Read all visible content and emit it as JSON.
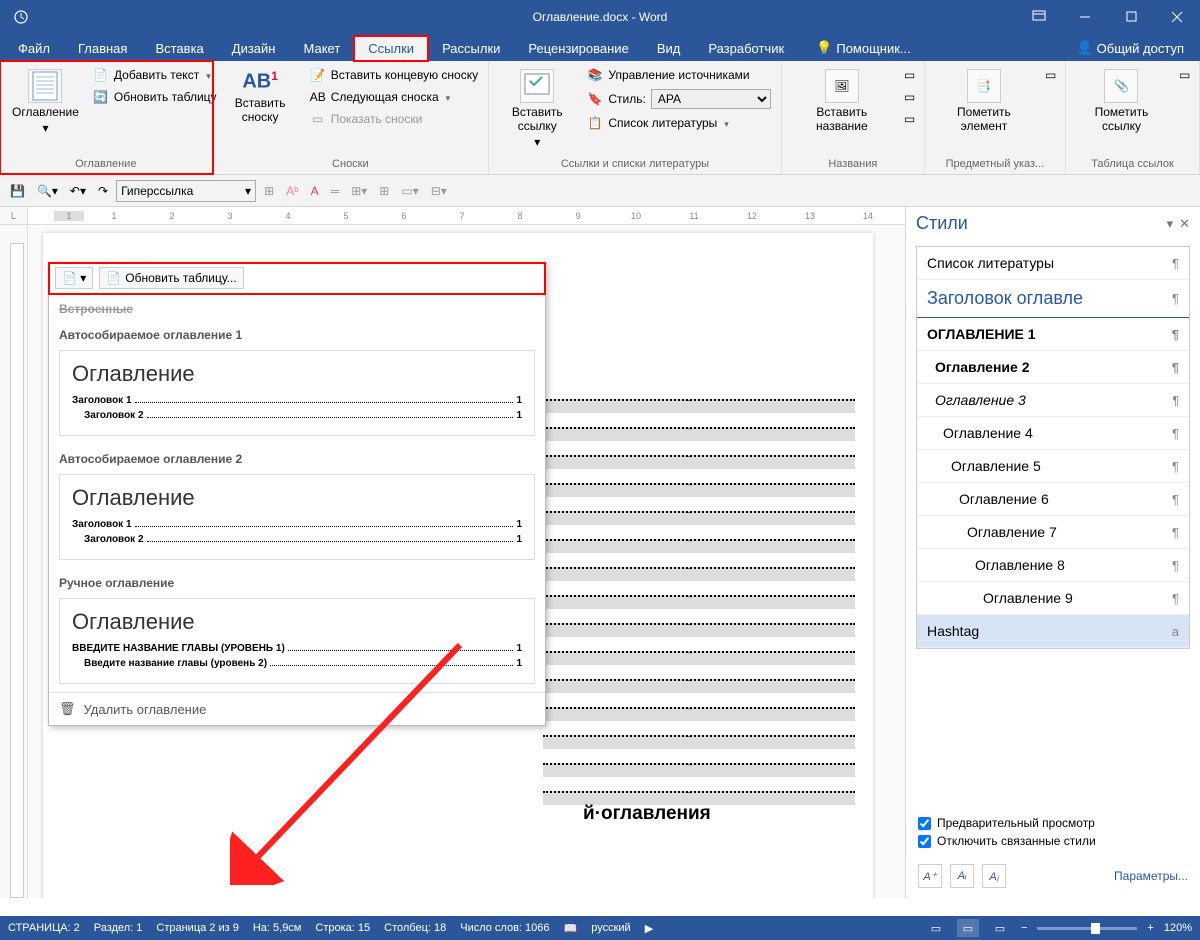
{
  "title": "Оглавление.docx - Word",
  "menutabs": [
    "Файл",
    "Главная",
    "Вставка",
    "Дизайн",
    "Макет",
    "Ссылки",
    "Рассылки",
    "Рецензирование",
    "Вид",
    "Разработчик"
  ],
  "active_tab": "Ссылки",
  "assist_label": "Помощник...",
  "share_label": "Общий доступ",
  "ribbon": {
    "g1": {
      "label": "Оглавление",
      "big": "Оглавление",
      "add_text": "Добавить текст",
      "update_table": "Обновить таблицу"
    },
    "g2": {
      "label": "Сноски",
      "big": "Вставить сноску",
      "ab": "АВ",
      "end_note": "Вставить концевую сноску",
      "next_note": "Следующая сноска",
      "show_notes": "Показать сноски"
    },
    "g3": {
      "label": "Ссылки и списки литературы",
      "big": "Вставить ссылку",
      "manage": "Управление источниками",
      "style_label": "Стиль:",
      "style_value": "APA",
      "bibliography": "Список литературы"
    },
    "g4": {
      "label": "Названия",
      "big": "Вставить название"
    },
    "g5": {
      "label": "Предметный указ...",
      "big": "Пометить элемент"
    },
    "g6": {
      "label": "Таблица ссылок",
      "big": "Пометить ссылку"
    }
  },
  "toolbar2": {
    "style": "Гиперссылка"
  },
  "ruler_numbers": [
    "1",
    "",
    "1",
    "2",
    "3",
    "4",
    "5",
    "6",
    "7",
    "8",
    "9",
    "10",
    "11",
    "12",
    "13",
    "14"
  ],
  "toc_gallery": {
    "update_btn": "Обновить таблицу...",
    "section_builtin": "Встроенные",
    "auto1": "Автособираемое оглавление 1",
    "auto2": "Автособираемое оглавление 2",
    "manual": "Ручное оглавление",
    "preview_title": "Оглавление",
    "h1": "Заголовок 1",
    "h2": "Заголовок 2",
    "m1": "ВВЕДИТЕ НАЗВАНИЕ ГЛАВЫ (УРОВЕНЬ 1)",
    "m2": "Введите название главы (уровень 2)",
    "page1": "1",
    "delete": "Удалить оглавление"
  },
  "doc_fragment": "й·оглавления",
  "styles_pane": {
    "title": "Стили",
    "items": [
      {
        "label": "Список литературы",
        "cls": ""
      },
      {
        "label": "Заголовок оглавле",
        "cls": "heading"
      },
      {
        "label": "ОГЛАВЛЕНИЕ 1",
        "cls": "bold"
      },
      {
        "label": "Оглавление 2",
        "cls": "bold indent-1"
      },
      {
        "label": "Оглавление 3",
        "cls": "italic indent-1"
      },
      {
        "label": "Оглавление 4",
        "cls": "indent-2"
      },
      {
        "label": "Оглавление 5",
        "cls": "indent-3"
      },
      {
        "label": "Оглавление 6",
        "cls": "indent-4"
      },
      {
        "label": "Оглавление 7",
        "cls": "indent-5"
      },
      {
        "label": "Оглавление 8",
        "cls": "indent-6"
      },
      {
        "label": "Оглавление 9",
        "cls": "indent-7"
      },
      {
        "label": "Hashtag",
        "cls": "sel"
      }
    ],
    "preview_cb": "Предварительный просмотр",
    "linked_cb": "Отключить связанные стили",
    "params": "Параметры..."
  },
  "statusbar": {
    "page": "СТРАНИЦА: 2",
    "section": "Раздел: 1",
    "page_of": "Страница 2 из 9",
    "pos": "На: 5,9см",
    "line": "Строка: 15",
    "col": "Столбец: 18",
    "words": "Число слов: 1066",
    "lang": "русский",
    "zoom": "120%"
  }
}
